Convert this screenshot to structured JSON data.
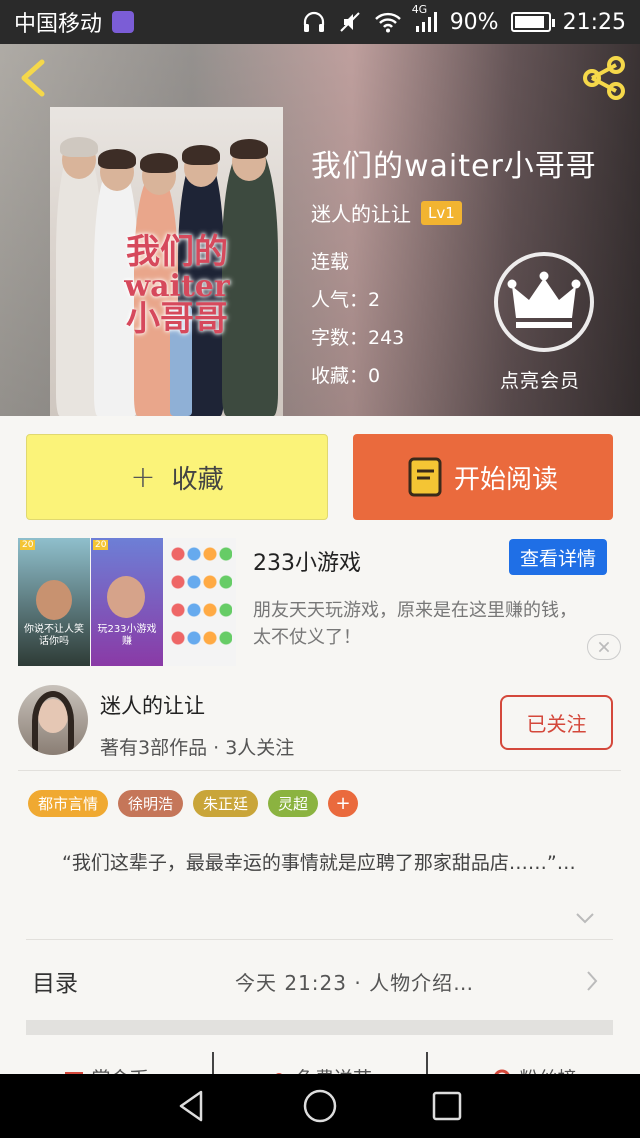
{
  "status_bar": {
    "carrier": "中国移动",
    "network": "4G",
    "battery": "90%",
    "battery_level": 0.9,
    "time": "21:25",
    "icons": [
      "headphones-icon",
      "mute-icon",
      "wifi-icon",
      "signal-icon",
      "battery-icon"
    ]
  },
  "header": {
    "back_icon": "back-arrow-icon",
    "share_icon": "share-icon",
    "cover": {
      "title_lines": [
        "我们的",
        "waiter",
        "小哥哥"
      ]
    },
    "book_title": "我们的waiter小哥哥",
    "author": "迷人的让让",
    "level": "Lv1",
    "status": "连载",
    "popularity": "人气：2",
    "word_count": "字数：243",
    "favorites": "收藏：0",
    "vip_label": "点亮会员",
    "vip_icon": "crown-icon"
  },
  "actions": {
    "collect_plus": "+",
    "collect_label": "收藏",
    "read_label": "开始阅读",
    "read_icon": "book-icon"
  },
  "ad": {
    "title": "233小游戏",
    "detail_label": "查看详情",
    "description": "朋友天天玩游戏，原来是在这里赚的钱，太不仗义了！",
    "thumb_texts": [
      "你说不让人笑话你吗",
      "玩233小游戏赚",
      "20",
      "20"
    ],
    "close_icon": "close-icon"
  },
  "author_info": {
    "name": "迷人的让让",
    "summary": "著有3部作品 · 3人关注",
    "follow_label": "已关注"
  },
  "tags": [
    {
      "label": "都市言情",
      "color": "#f0a931"
    },
    {
      "label": "徐明浩",
      "color": "#c57659"
    },
    {
      "label": "朱正廷",
      "color": "#c9a539"
    },
    {
      "label": "灵超",
      "color": "#8bb340"
    }
  ],
  "tag_add": "+",
  "intro": "“我们这辈子，最最幸运的事情就是应聘了那家甜品店……”…",
  "toc": {
    "label": "目录",
    "latest": "今天 21:23 · 人物介绍…"
  },
  "bottom_tabs": [
    {
      "label": "赏金币",
      "icon": "gift-icon"
    },
    {
      "label": "免费送花",
      "icon": "flower-icon"
    },
    {
      "label": "粉丝榜",
      "icon": "trophy-icon"
    }
  ],
  "nav": [
    "back-nav-icon",
    "home-nav-icon",
    "recent-apps-icon"
  ],
  "colors": {
    "accent_orange": "#ea6a3d",
    "collect_yellow": "#fbf379",
    "follow_red": "#d4483b",
    "detail_blue": "#1f6fe6",
    "level_gold": "#f2b431"
  }
}
